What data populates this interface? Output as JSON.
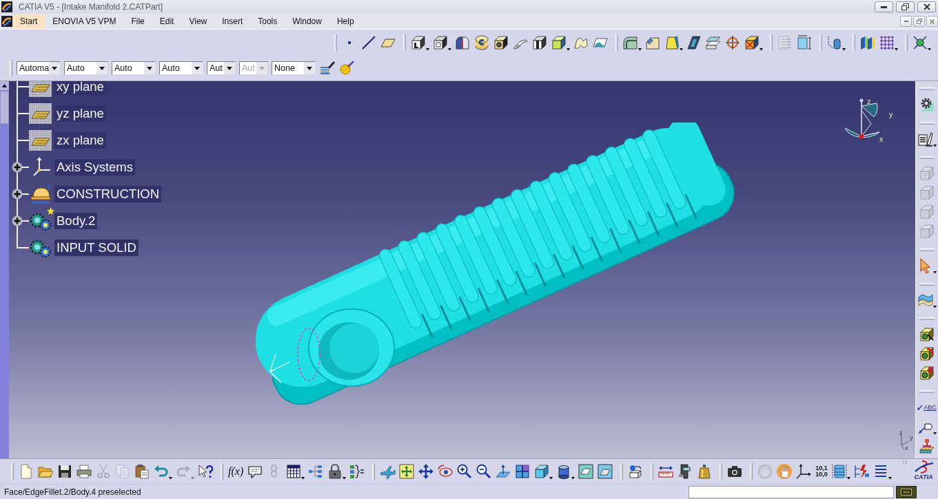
{
  "window": {
    "title": "CATIA V5 - [Intake Manifold 2.CATPart]"
  },
  "menu": [
    {
      "label": "Start",
      "selected": true
    },
    {
      "label": "ENOVIA V5 VPM",
      "selected": false
    },
    {
      "label": "File",
      "selected": false
    },
    {
      "label": "Edit",
      "selected": false
    },
    {
      "label": "View",
      "selected": false
    },
    {
      "label": "Insert",
      "selected": false
    },
    {
      "label": "Tools",
      "selected": false
    },
    {
      "label": "Window",
      "selected": false
    },
    {
      "label": "Help",
      "selected": false
    }
  ],
  "top_toolbars": [
    {
      "buttons": [
        {
          "kind": "point",
          "disabled": false
        },
        {
          "kind": "line",
          "disabled": false
        },
        {
          "kind": "plane",
          "disabled": false
        }
      ]
    },
    {
      "buttons": [
        {
          "kind": "pad",
          "disabled": false
        },
        {
          "kind": "pocket",
          "disabled": false
        },
        {
          "kind": "shaft",
          "disabled": false
        },
        {
          "kind": "groove",
          "disabled": false
        },
        {
          "kind": "hole",
          "disabled": false
        },
        {
          "kind": "rib",
          "disabled": false
        },
        {
          "kind": "slot",
          "disabled": false
        },
        {
          "kind": "solid",
          "disabled": false
        },
        {
          "kind": "loft",
          "disabled": false
        },
        {
          "kind": "cut_surface",
          "disabled": false
        }
      ]
    },
    {
      "buttons": [
        {
          "kind": "fillet",
          "disabled": false
        },
        {
          "kind": "chamfer",
          "disabled": false
        },
        {
          "kind": "draft",
          "disabled": false
        },
        {
          "kind": "shell",
          "disabled": false
        },
        {
          "kind": "thickness",
          "disabled": false
        },
        {
          "kind": "thread",
          "disabled": false
        },
        {
          "kind": "remove_face",
          "disabled": false
        }
      ]
    },
    {
      "buttons": [
        {
          "kind": "lines",
          "disabled": true
        },
        {
          "kind": "dimension_box",
          "disabled": false
        }
      ]
    },
    {
      "buttons": [
        {
          "kind": "cylinders",
          "disabled": false
        }
      ]
    },
    {
      "buttons": [
        {
          "kind": "prisms",
          "disabled": false
        },
        {
          "kind": "dot_grid",
          "disabled": false
        }
      ]
    },
    {
      "buttons": [
        {
          "kind": "node",
          "disabled": false
        }
      ]
    }
  ],
  "properties_bar": {
    "fields": [
      {
        "value": "Automa",
        "disabled": false
      },
      {
        "value": "Auto",
        "disabled": false
      },
      {
        "value": "Auto",
        "disabled": false
      },
      {
        "value": "Auto",
        "disabled": false
      },
      {
        "value": "Aut",
        "disabled": false
      },
      {
        "value": "Aut",
        "disabled": true
      },
      {
        "value": "None",
        "disabled": false
      }
    ],
    "buttons": [
      {
        "kind": "brush",
        "disabled": false
      },
      {
        "kind": "paint",
        "disabled": false
      }
    ]
  },
  "tree": {
    "items": [
      {
        "label": "xy plane",
        "kind": "plane",
        "expandable": false,
        "in_work": false
      },
      {
        "label": "yz plane",
        "kind": "plane",
        "expandable": false,
        "in_work": false
      },
      {
        "label": "zx plane",
        "kind": "plane",
        "expandable": false,
        "in_work": false
      },
      {
        "label": "Axis Systems",
        "kind": "axis",
        "expandable": true,
        "in_work": false
      },
      {
        "label": "CONSTRUCTION",
        "kind": "construction",
        "expandable": true,
        "in_work": false
      },
      {
        "label": "Body.2",
        "kind": "body",
        "expandable": true,
        "in_work": true
      },
      {
        "label": "INPUT SOLID",
        "kind": "body",
        "expandable": false,
        "in_work": false
      }
    ]
  },
  "compass": {
    "labels": [
      "z",
      "y",
      "x"
    ]
  },
  "corner_axis": {
    "labels": [
      "z",
      "y",
      "x"
    ]
  },
  "right_toolbars": [
    {
      "buttons": [
        {
          "kind": "gear",
          "disabled": false
        }
      ]
    },
    {
      "buttons": [
        {
          "kind": "sketch",
          "disabled": false
        }
      ]
    },
    {
      "buttons": [
        {
          "kind": "block",
          "disabled": true
        },
        {
          "kind": "block",
          "disabled": true
        },
        {
          "kind": "block",
          "disabled": true
        },
        {
          "kind": "block",
          "disabled": true
        }
      ]
    },
    {
      "buttons": [
        {
          "kind": "select",
          "disabled": false
        }
      ]
    },
    {
      "buttons": [
        {
          "kind": "surface",
          "disabled": false
        }
      ]
    },
    {
      "buttons": [
        {
          "kind": "bool_add",
          "disabled": false
        },
        {
          "kind": "bool_remove",
          "disabled": false
        },
        {
          "kind": "bool_intersect",
          "disabled": false
        }
      ]
    },
    {
      "buttons": [
        {
          "kind": "annotation",
          "label": "ABC",
          "disabled": false
        },
        {
          "kind": "flag",
          "disabled": false
        },
        {
          "kind": "stamp",
          "disabled": false
        }
      ]
    }
  ],
  "bottom_toolbars": [
    {
      "buttons": [
        {
          "kind": "new",
          "disabled": false
        },
        {
          "kind": "open",
          "disabled": false
        },
        {
          "kind": "save",
          "disabled": false
        },
        {
          "kind": "print",
          "disabled": false
        },
        {
          "kind": "cut",
          "disabled": true
        },
        {
          "kind": "copy",
          "disabled": true
        },
        {
          "kind": "paste",
          "disabled": false
        },
        {
          "kind": "undo",
          "disabled": false
        },
        {
          "kind": "redo",
          "disabled": true
        },
        {
          "kind": "help",
          "disabled": false
        }
      ]
    },
    {
      "buttons": [
        {
          "kind": "formula",
          "label": "f(x)",
          "disabled": false
        },
        {
          "kind": "comment",
          "disabled": false
        },
        {
          "kind": "link",
          "disabled": true
        },
        {
          "kind": "table",
          "disabled": false
        },
        {
          "kind": "network",
          "disabled": false
        },
        {
          "kind": "lock",
          "disabled": false
        },
        {
          "kind": "rules",
          "disabled": false
        }
      ]
    },
    {
      "buttons": [
        {
          "kind": "fly",
          "disabled": false
        },
        {
          "kind": "fit",
          "disabled": false
        },
        {
          "kind": "pan",
          "disabled": false
        },
        {
          "kind": "rotate",
          "disabled": false
        },
        {
          "kind": "zoom_in",
          "disabled": false
        },
        {
          "kind": "zoom_out",
          "disabled": false
        },
        {
          "kind": "normal",
          "disabled": false
        },
        {
          "kind": "multi_view",
          "disabled": false
        },
        {
          "kind": "iso",
          "disabled": false
        },
        {
          "kind": "shading",
          "disabled": false
        },
        {
          "kind": "hide",
          "disabled": false
        },
        {
          "kind": "swap",
          "disabled": false
        }
      ]
    },
    {
      "buttons": [
        {
          "kind": "manipulate",
          "disabled": false
        }
      ]
    },
    {
      "buttons": [
        {
          "kind": "measure",
          "disabled": false
        },
        {
          "kind": "measure_item",
          "disabled": false
        },
        {
          "kind": "inertia",
          "disabled": false
        }
      ]
    },
    {
      "buttons": [
        {
          "kind": "camera",
          "disabled": false
        }
      ]
    },
    {
      "buttons": [
        {
          "kind": "swirl",
          "disabled": true
        },
        {
          "kind": "hand",
          "disabled": false
        },
        {
          "kind": "axis",
          "disabled": false
        },
        {
          "kind": "coordinates",
          "label": "10,1\n10,0",
          "disabled": false
        },
        {
          "kind": "layers",
          "disabled": false
        },
        {
          "kind": "bolt",
          "disabled": false
        },
        {
          "kind": "list",
          "disabled": false
        }
      ]
    }
  ],
  "logo": {
    "text": "CATIA"
  },
  "status_bar": {
    "message": "Face/EdgeFillet.2/Body.4 preselected"
  }
}
